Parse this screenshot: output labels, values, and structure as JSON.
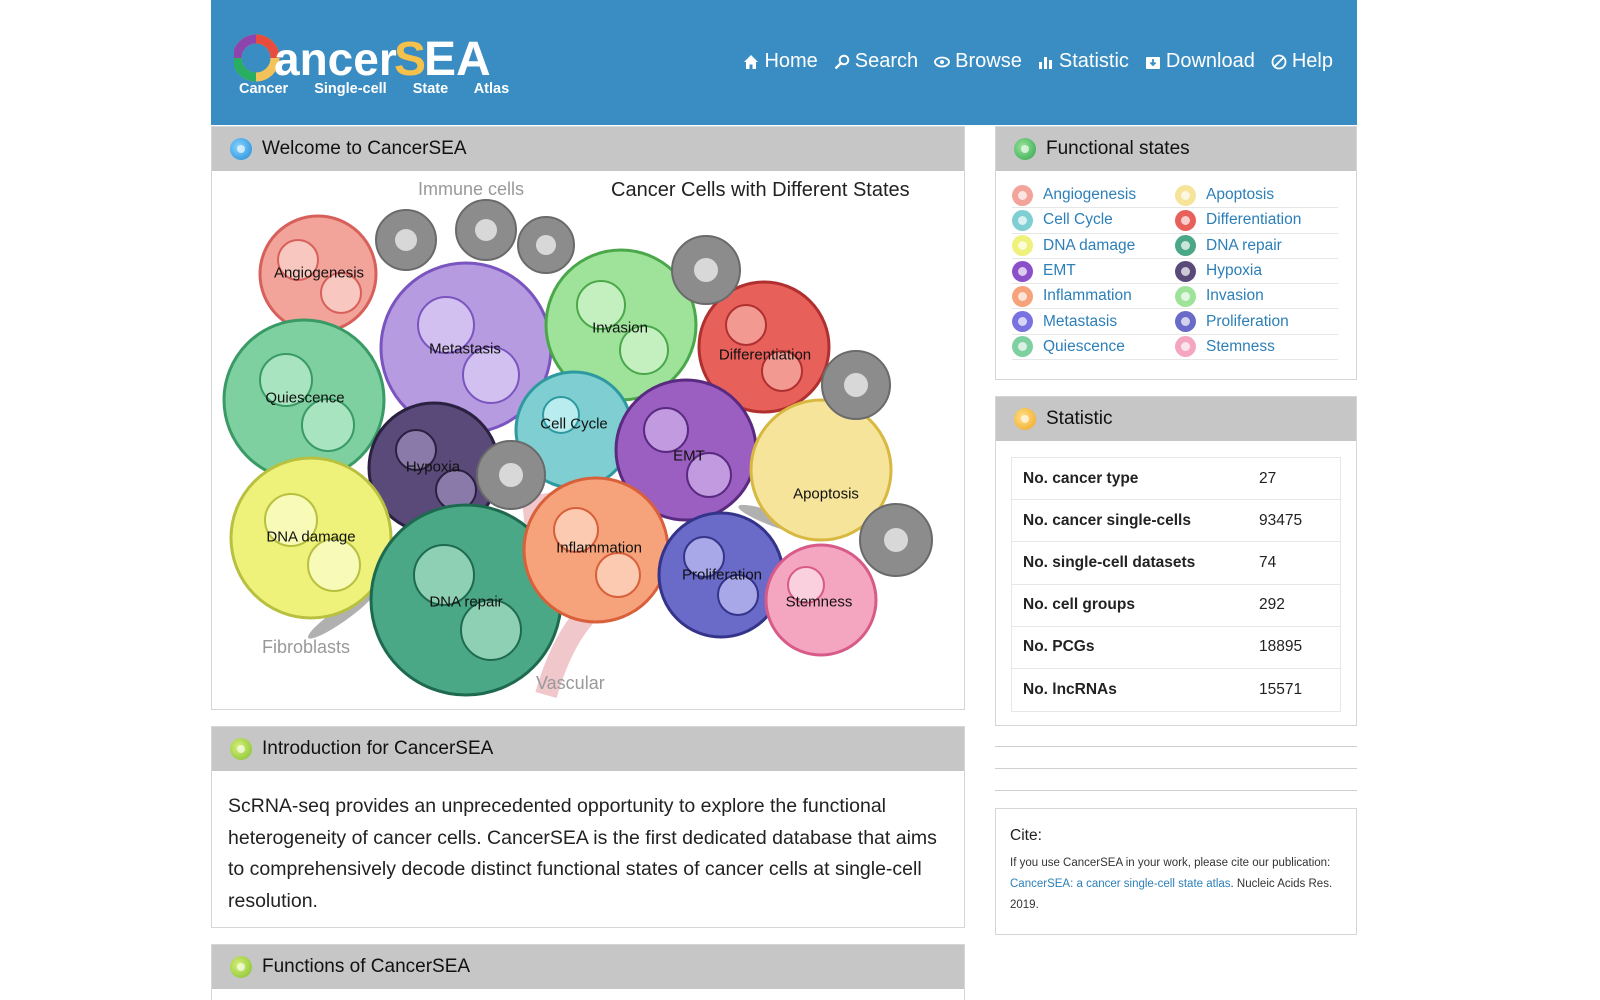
{
  "logo": {
    "name": "CancerSEA",
    "tagline": "Cancer Single-cell State Atlas"
  },
  "nav": [
    {
      "label": "Home",
      "icon": "home-icon"
    },
    {
      "label": "Search",
      "icon": "search-icon"
    },
    {
      "label": "Browse",
      "icon": "eye-icon"
    },
    {
      "label": "Statistic",
      "icon": "bar-chart-icon"
    },
    {
      "label": "Download",
      "icon": "download-icon"
    },
    {
      "label": "Help",
      "icon": "help-icon"
    }
  ],
  "welcome": {
    "title": "Welcome to CancerSEA",
    "figure_title": "Cancer Cells with Different States",
    "immune": "Immune cells",
    "fibroblasts": "Fibroblasts",
    "vascular": "Vascular",
    "states": [
      "Angiogenesis",
      "Metastasis",
      "Invasion",
      "Differentiation",
      "Quiescence",
      "Cell Cycle",
      "Hypoxia",
      "EMT",
      "Apoptosis",
      "DNA damage",
      "Inflammation",
      "Proliferation",
      "DNA repair",
      "Stemness"
    ]
  },
  "intro": {
    "title": "Introduction for CancerSEA",
    "text": "ScRNA-seq provides an unprecedented opportunity to explore the functional heterogeneity of cancer cells. CancerSEA is the first dedicated database that aims to comprehensively decode distinct functional states of cancer cells at single-cell resolution."
  },
  "functions": {
    "title": "Functions of CancerSEA"
  },
  "functional_states": {
    "title": "Functional states",
    "items": [
      {
        "label": "Angiogenesis",
        "color": "#f2a39a"
      },
      {
        "label": "Apoptosis",
        "color": "#f5e49a"
      },
      {
        "label": "Cell Cycle",
        "color": "#7fcfd2"
      },
      {
        "label": "Differentiation",
        "color": "#e8605a"
      },
      {
        "label": "DNA damage",
        "color": "#eef27a"
      },
      {
        "label": "DNA repair",
        "color": "#4aa886"
      },
      {
        "label": "EMT",
        "color": "#8a4fc9"
      },
      {
        "label": "Hypoxia",
        "color": "#5a4a7a"
      },
      {
        "label": "Inflammation",
        "color": "#f6a27a"
      },
      {
        "label": "Invasion",
        "color": "#9fe39a"
      },
      {
        "label": "Metastasis",
        "color": "#7a72e0"
      },
      {
        "label": "Proliferation",
        "color": "#6a6ac8"
      },
      {
        "label": "Quiescence",
        "color": "#7fd0a0"
      },
      {
        "label": "Stemness",
        "color": "#f4a6c0"
      }
    ]
  },
  "statistic": {
    "title": "Statistic",
    "rows": [
      {
        "label": "No. cancer type",
        "value": "27"
      },
      {
        "label": "No. cancer single-cells",
        "value": "93475"
      },
      {
        "label": "No. single-cell datasets",
        "value": "74"
      },
      {
        "label": "No. cell groups",
        "value": "292"
      },
      {
        "label": "No. PCGs",
        "value": "18895"
      },
      {
        "label": "No. lncRNAs",
        "value": "15571"
      }
    ]
  },
  "cite": {
    "title": "Cite:",
    "intro": "If you use CancerSEA in your work, please cite our publication:",
    "link": "CancerSEA: a cancer single-cell state atlas",
    "rest": ". Nucleic Acids Res. 2019."
  }
}
